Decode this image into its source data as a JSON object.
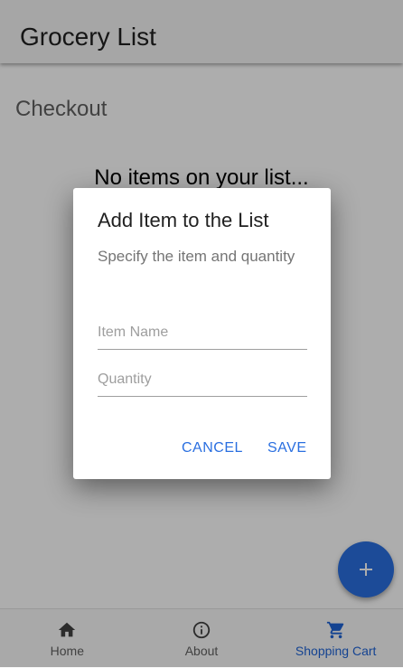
{
  "app": {
    "title": "Grocery List"
  },
  "page": {
    "heading": "Checkout",
    "empty_message": "No items on your list..."
  },
  "fab": {
    "icon": "plus-icon"
  },
  "bottom_nav": {
    "items": [
      {
        "label": "Home",
        "icon": "home-icon",
        "active": false
      },
      {
        "label": "About",
        "icon": "info-icon",
        "active": false
      },
      {
        "label": "Shopping Cart",
        "icon": "cart-icon",
        "active": true
      }
    ]
  },
  "dialog": {
    "title": "Add Item to the List",
    "text": "Specify the item and quantity",
    "item_name": {
      "placeholder": "Item Name",
      "value": ""
    },
    "quantity": {
      "placeholder": "Quantity",
      "value": ""
    },
    "cancel_label": "CANCEL",
    "save_label": "SAVE"
  },
  "colors": {
    "accent": "#2a6fe0",
    "active_nav": "#1e63d6",
    "appbar": "#f5f5f5"
  }
}
